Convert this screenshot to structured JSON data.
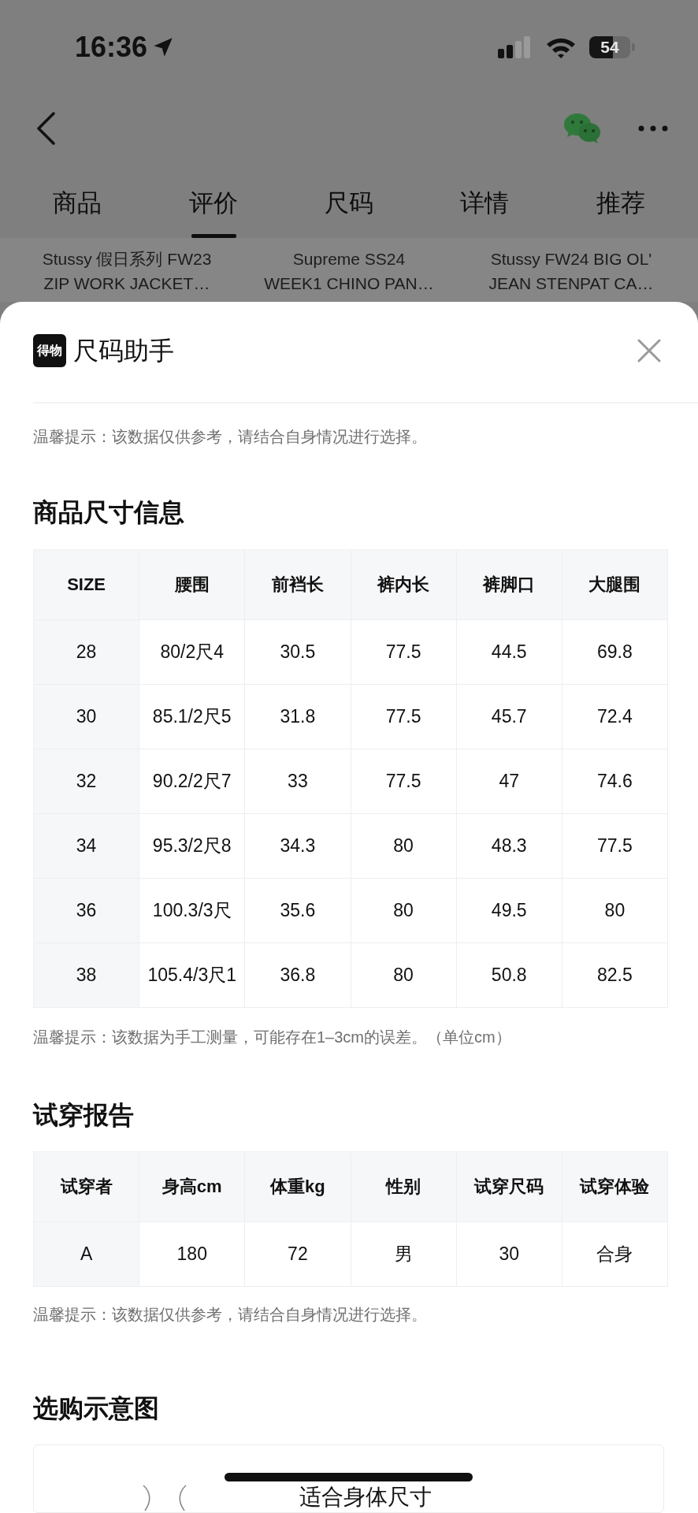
{
  "status_bar": {
    "time": "16:36",
    "battery": "54"
  },
  "tabs": [
    {
      "label": "商品",
      "selected": false
    },
    {
      "label": "评价",
      "selected": true
    },
    {
      "label": "尺码",
      "selected": false
    },
    {
      "label": "详情",
      "selected": false
    },
    {
      "label": "推荐",
      "selected": false
    }
  ],
  "products": [
    {
      "title": "Stussy 假日系列 FW23\nZIP WORK JACKET…"
    },
    {
      "title": "Supreme SS24\nWEEK1 CHINO PAN…"
    },
    {
      "title": "Stussy FW24 BIG OL'\nJEAN STENPAT CA…"
    }
  ],
  "size_helper": {
    "logo": "得物",
    "title": "尺码助手",
    "hint": "温馨提示：该数据仅供参考，请结合自身情况进行选择。"
  },
  "size_table": {
    "heading": "商品尺寸信息",
    "columns": [
      "SIZE",
      "腰围",
      "前裆长",
      "裤内长",
      "裤脚口",
      "大腿围"
    ],
    "rows": [
      [
        "28",
        "80/2尺4",
        "30.5",
        "77.5",
        "44.5",
        "69.8"
      ],
      [
        "30",
        "85.1/2尺5",
        "31.8",
        "77.5",
        "45.7",
        "72.4"
      ],
      [
        "32",
        "90.2/2尺7",
        "33",
        "77.5",
        "47",
        "74.6"
      ],
      [
        "34",
        "95.3/2尺8",
        "34.3",
        "80",
        "48.3",
        "77.5"
      ],
      [
        "36",
        "100.3/3尺",
        "35.6",
        "80",
        "49.5",
        "80"
      ],
      [
        "38",
        "105.4/3尺1",
        "36.8",
        "80",
        "50.8",
        "82.5"
      ]
    ],
    "note": "温馨提示：该数据为手工测量，可能存在1–3cm的误差。（单位cm）"
  },
  "fitting_report": {
    "heading": "试穿报告",
    "columns": [
      "试穿者",
      "身高cm",
      "体重kg",
      "性别",
      "试穿尺码",
      "试穿体验"
    ],
    "rows": [
      [
        "A",
        "180",
        "72",
        "男",
        "30",
        "合身"
      ]
    ],
    "note": "温馨提示：该数据仅供参考，请结合自身情况进行选择。"
  },
  "purchase_guide": {
    "heading": "选购示意图",
    "caption": "适合身体尺寸"
  }
}
